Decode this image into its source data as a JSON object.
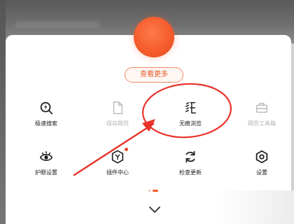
{
  "menu": {
    "more_button": "查看更多",
    "tools": [
      {
        "label": "极速搜索",
        "icon": "lightning-search-icon",
        "enabled": true
      },
      {
        "label": "保存网页",
        "icon": "document-icon",
        "enabled": false
      },
      {
        "label": "无痕浏览",
        "icon": "incognito-icon",
        "enabled": true
      },
      {
        "label": "网页工具箱",
        "icon": "toolbox-icon",
        "enabled": false
      },
      {
        "label": "护眼设置",
        "icon": "eye-care-icon",
        "enabled": true
      },
      {
        "label": "插件中心",
        "icon": "plugin-icon",
        "enabled": true,
        "badge": true
      },
      {
        "label": "检查更新",
        "icon": "refresh-icon",
        "enabled": true
      },
      {
        "label": "设置",
        "icon": "settings-hex-icon",
        "enabled": true
      }
    ]
  },
  "colors": {
    "accent": "#f05a2a",
    "annotation": "#e8322a"
  }
}
